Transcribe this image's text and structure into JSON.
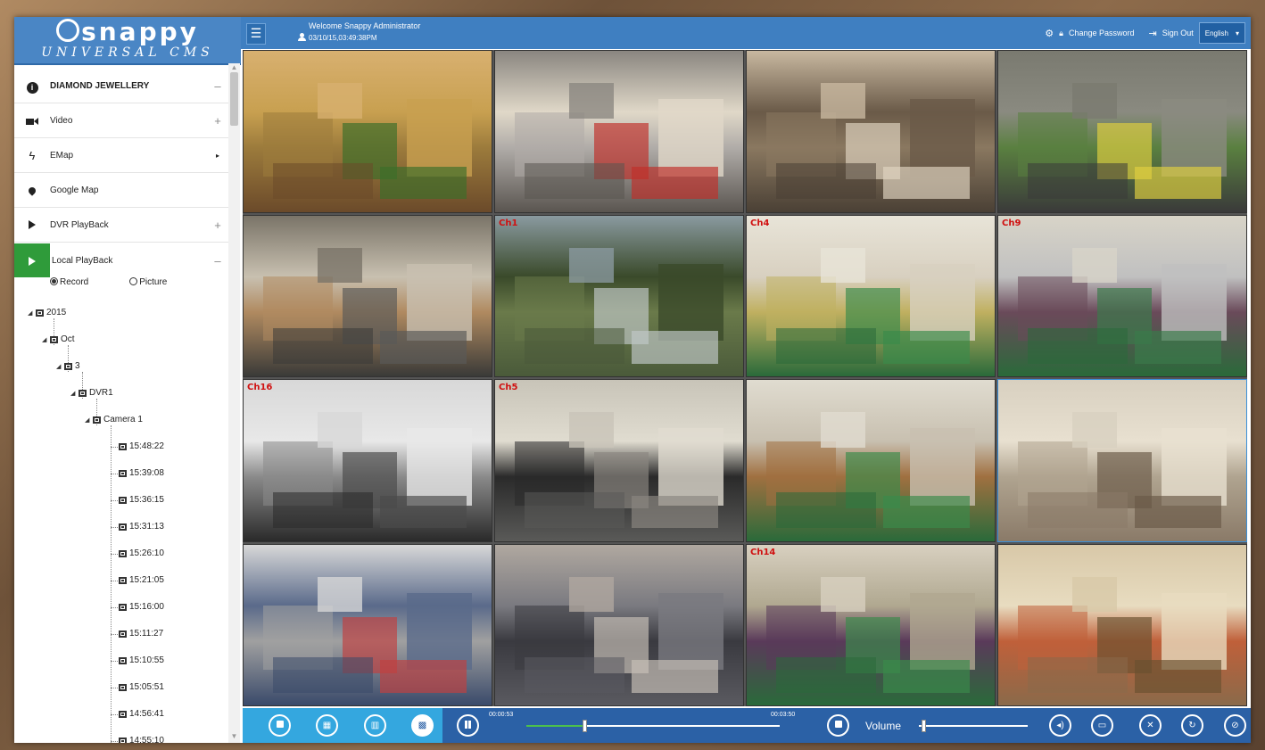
{
  "brand": {
    "name": "Snappy",
    "subtitle": "UNIVERSAL CMS"
  },
  "header": {
    "welcome": "Welcome Snappy Administrator",
    "datetime": "03/10/15,03:49:38PM",
    "change_password": "Change Password",
    "sign_out": "Sign Out",
    "language": "English"
  },
  "sidebar": {
    "site": {
      "label": "DIAMOND JEWELLERY",
      "toggle": "–"
    },
    "items": [
      {
        "label": "Video",
        "icon": "video-camera-icon",
        "toggle": "+"
      },
      {
        "label": "EMap",
        "icon": "lightning-icon",
        "toggle": "▸"
      },
      {
        "label": "Google Map",
        "icon": "map-pin-icon",
        "toggle": ""
      },
      {
        "label": "DVR PlayBack",
        "icon": "play-icon",
        "toggle": "+"
      },
      {
        "label": "Local PlayBack",
        "icon": "play-icon",
        "toggle": "–"
      }
    ],
    "radio": {
      "record": "Record",
      "picture": "Picture",
      "selected": "record"
    },
    "tree": {
      "year": "2015",
      "month": "Oct",
      "day": "3",
      "dvr": "DVR1",
      "camera": "Camera 1",
      "records": [
        "15:48:22",
        "15:39:08",
        "15:36:15",
        "15:31:13",
        "15:26:10",
        "15:21:05",
        "15:16:00",
        "15:11:27",
        "15:10:55",
        "15:05:51",
        "14:56:41",
        "14:55:10"
      ]
    }
  },
  "grid": {
    "cells": [
      {
        "scene": "Supermarket produce aisle",
        "channel": ""
      },
      {
        "scene": "City street traffic",
        "channel": ""
      },
      {
        "scene": "Warehouse shelving aisle",
        "channel": ""
      },
      {
        "scene": "Street crossing from above",
        "channel": ""
      },
      {
        "scene": "Warehouse loading floor",
        "channel": ""
      },
      {
        "scene": "Park with trees",
        "channel": "Ch1"
      },
      {
        "scene": "Office with green carpet",
        "channel": "Ch4"
      },
      {
        "scene": "Lobby with green carpet",
        "channel": "Ch9"
      },
      {
        "scene": "Server room",
        "channel": "Ch16"
      },
      {
        "scene": "Building entrance with car",
        "channel": "Ch5"
      },
      {
        "scene": "Lobby seating area",
        "channel": ""
      },
      {
        "scene": "Empty corridor",
        "channel": ""
      },
      {
        "scene": "Office cubicles",
        "channel": ""
      },
      {
        "scene": "Mall escalators",
        "channel": ""
      },
      {
        "scene": "Reception desk",
        "channel": "Ch14"
      },
      {
        "scene": "Cafeteria",
        "channel": ""
      }
    ],
    "selected_index": 11
  },
  "playback": {
    "current_time": "00:00:53",
    "total_time": "00:03:50",
    "progress": 0.23,
    "volume_label": "Volume",
    "volume": 0.04
  },
  "colors": {
    "header_blue": "#3f7fc1",
    "toolbar_blue": "#2b61a6",
    "view_group_blue": "#34a7df",
    "active_green": "#2f9b3a",
    "channel_red": "#d01010"
  }
}
